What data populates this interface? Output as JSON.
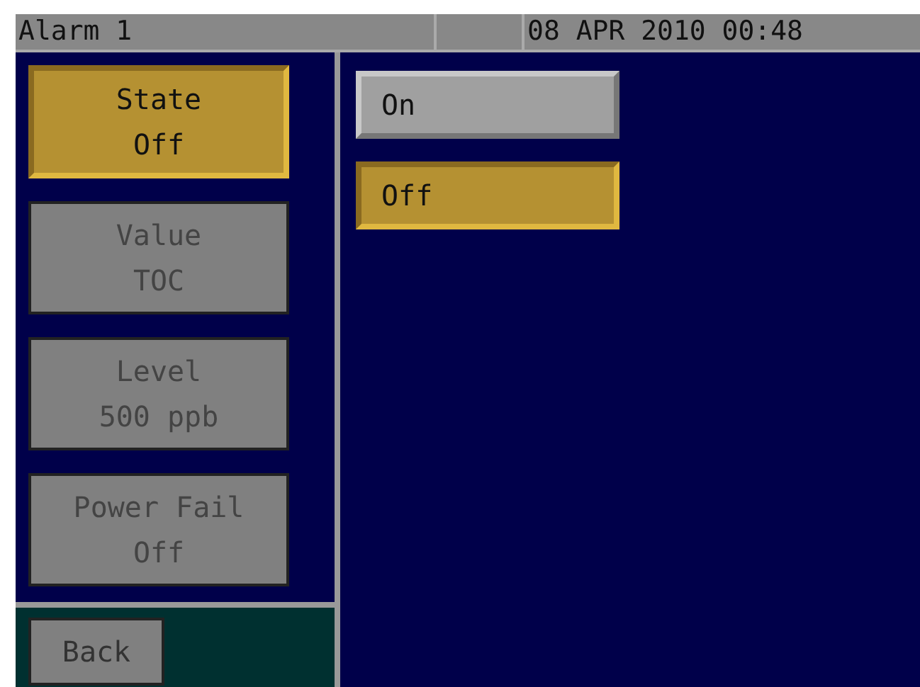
{
  "title_bar": {
    "title": "Alarm 1",
    "datetime": "08 APR 2010 00:48"
  },
  "menu": [
    {
      "label": "State",
      "value": "Off",
      "selected": true
    },
    {
      "label": "Value",
      "value": "TOC",
      "selected": false
    },
    {
      "label": "Level",
      "value": "500 ppb",
      "selected": false
    },
    {
      "label": "Power Fail",
      "value": "Off",
      "selected": false
    }
  ],
  "options": [
    {
      "label": "On",
      "selected": false
    },
    {
      "label": "Off",
      "selected": true
    }
  ],
  "back_button": "Back"
}
